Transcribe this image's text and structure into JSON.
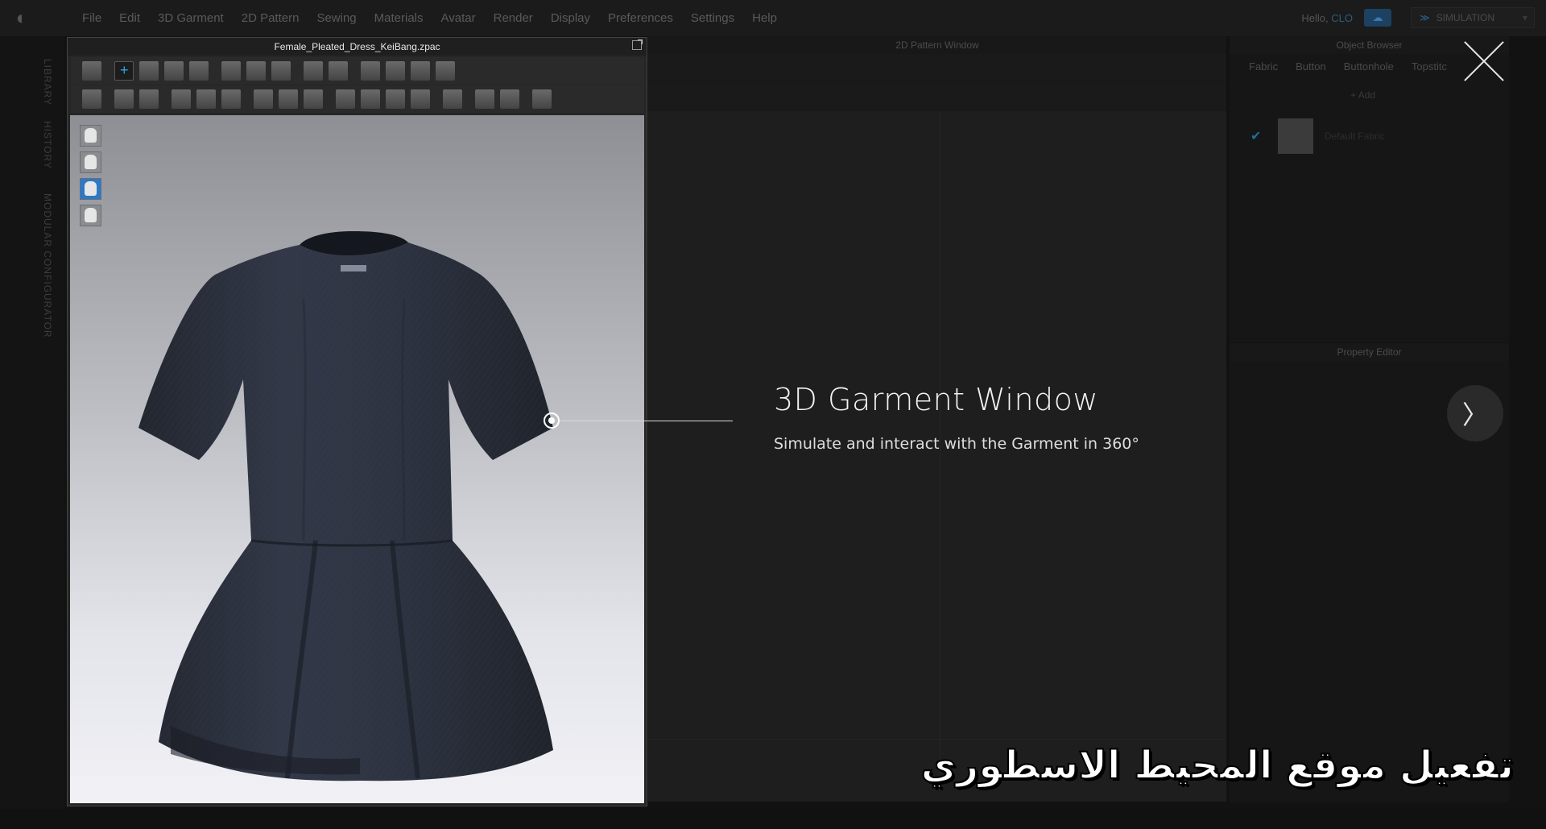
{
  "menubar": {
    "items": [
      "File",
      "Edit",
      "3D Garment",
      "2D Pattern",
      "Sewing",
      "Materials",
      "Avatar",
      "Render",
      "Display",
      "Preferences",
      "Settings",
      "Help"
    ],
    "greeting": "Hello,",
    "user": "CLO",
    "simulation_label": "SIMULATION"
  },
  "side_tabs": [
    "LIBRARY",
    "HISTORY",
    "MODULAR CONFIGURATOR"
  ],
  "garment_window": {
    "title": "Female_Pleated_Dress_KeiBang.zpac"
  },
  "pattern_window": {
    "title": "2D Pattern Window"
  },
  "object_browser": {
    "title": "Object Browser",
    "tabs": [
      "Fabric",
      "Button",
      "Buttonhole",
      "Topstitc"
    ],
    "add_label": "Add",
    "fabric_name": "Default Fabric"
  },
  "property_editor": {
    "title": "Property Editor"
  },
  "tutorial": {
    "title": "3D Garment Window",
    "subtitle": "Simulate and interact with the Garment in 360°"
  },
  "watermark": "تفعيل موقع المحيط الاسطوري",
  "colors": {
    "accent_blue": "#28a8e0",
    "dress": "#2c3140",
    "overlay_text": "#f2f2f2"
  }
}
